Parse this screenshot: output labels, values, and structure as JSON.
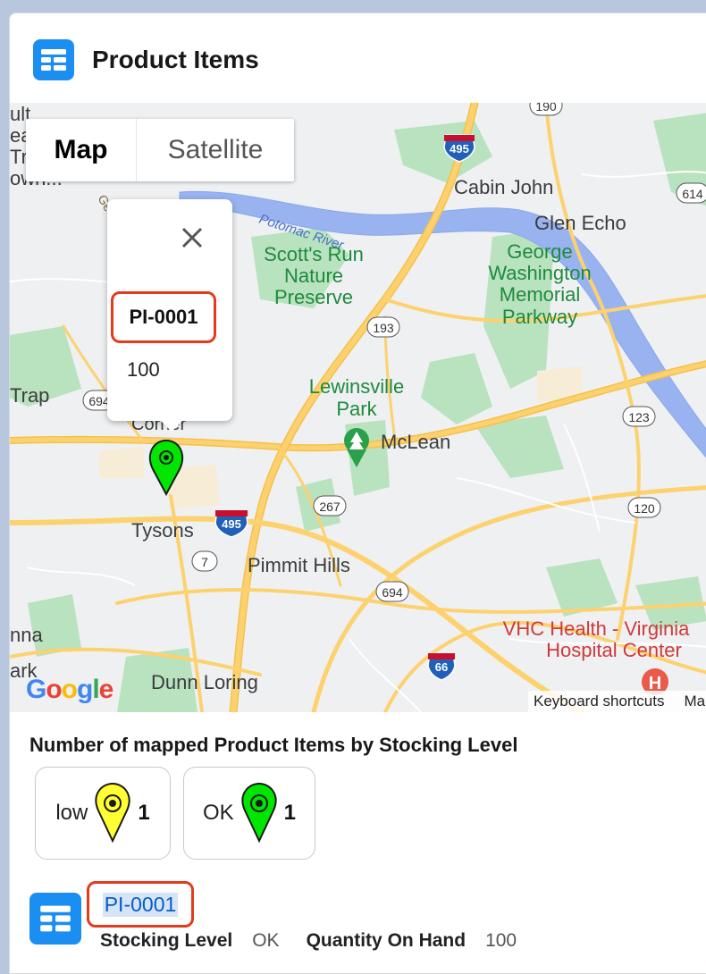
{
  "header": {
    "title": "Product Items",
    "icon": "table-icon"
  },
  "map": {
    "type_controls": {
      "map_label": "Map",
      "satellite_label": "Satellite",
      "selected": "Map"
    },
    "popup": {
      "id": "PI-0001",
      "quantity": "100"
    },
    "place_labels": {
      "cabin_john": "Cabin John",
      "glen_echo": "Glen Echo",
      "george_washington": [
        "George",
        "Washington",
        "Memorial",
        "Parkway"
      ],
      "potomac": "Potomac River",
      "scotts_run": [
        "Scott's Run",
        "Nature",
        "Preserve"
      ],
      "lewinsville": [
        "Lewinsville",
        "Park"
      ],
      "mclean": "McLean",
      "tysons": "Tysons",
      "pimmit_hills": "Pimmit Hills",
      "vhc": [
        "VHC Health - Virginia",
        "Hospital Center"
      ],
      "dunn_loring": "Dunn Loring",
      "trap": "Trap",
      "nna": "nna",
      "ark": "ark",
      "ult": "ult",
      "ea": "ea",
      "tr": "Tr",
      "own": "own...",
      "corner": "Corner",
      "ge": "Ge"
    },
    "shields": {
      "i495_top": "495",
      "i495_bottom": "495",
      "i66": "66",
      "r190": "190",
      "r614": "614",
      "r193": "193",
      "r694a": "694",
      "r694b": "694",
      "r267": "267",
      "r123": "123",
      "r120": "120",
      "r7": "7"
    },
    "attribution": {
      "google": "Google",
      "keyboard": "Keyboard shortcuts",
      "trail": "Ma"
    },
    "marker": {
      "stocking_level": "OK",
      "color": "#00e600"
    }
  },
  "legend": {
    "title": "Number of mapped Product Items by Stocking Level",
    "items": [
      {
        "label": "low",
        "count": "1",
        "color": "#ffff33"
      },
      {
        "label": "OK",
        "count": "1",
        "color": "#00e600"
      }
    ]
  },
  "record": {
    "id": "PI-0001",
    "fields": [
      {
        "label": "Stocking Level",
        "value": "OK"
      },
      {
        "label": "Quantity On Hand",
        "value": "100"
      }
    ]
  },
  "colors": {
    "accent": "#1b8ef2",
    "highlight_border": "#e23b1e",
    "road": "#fdd26e",
    "water": "#99b3f1",
    "park": "#aadcb4"
  }
}
